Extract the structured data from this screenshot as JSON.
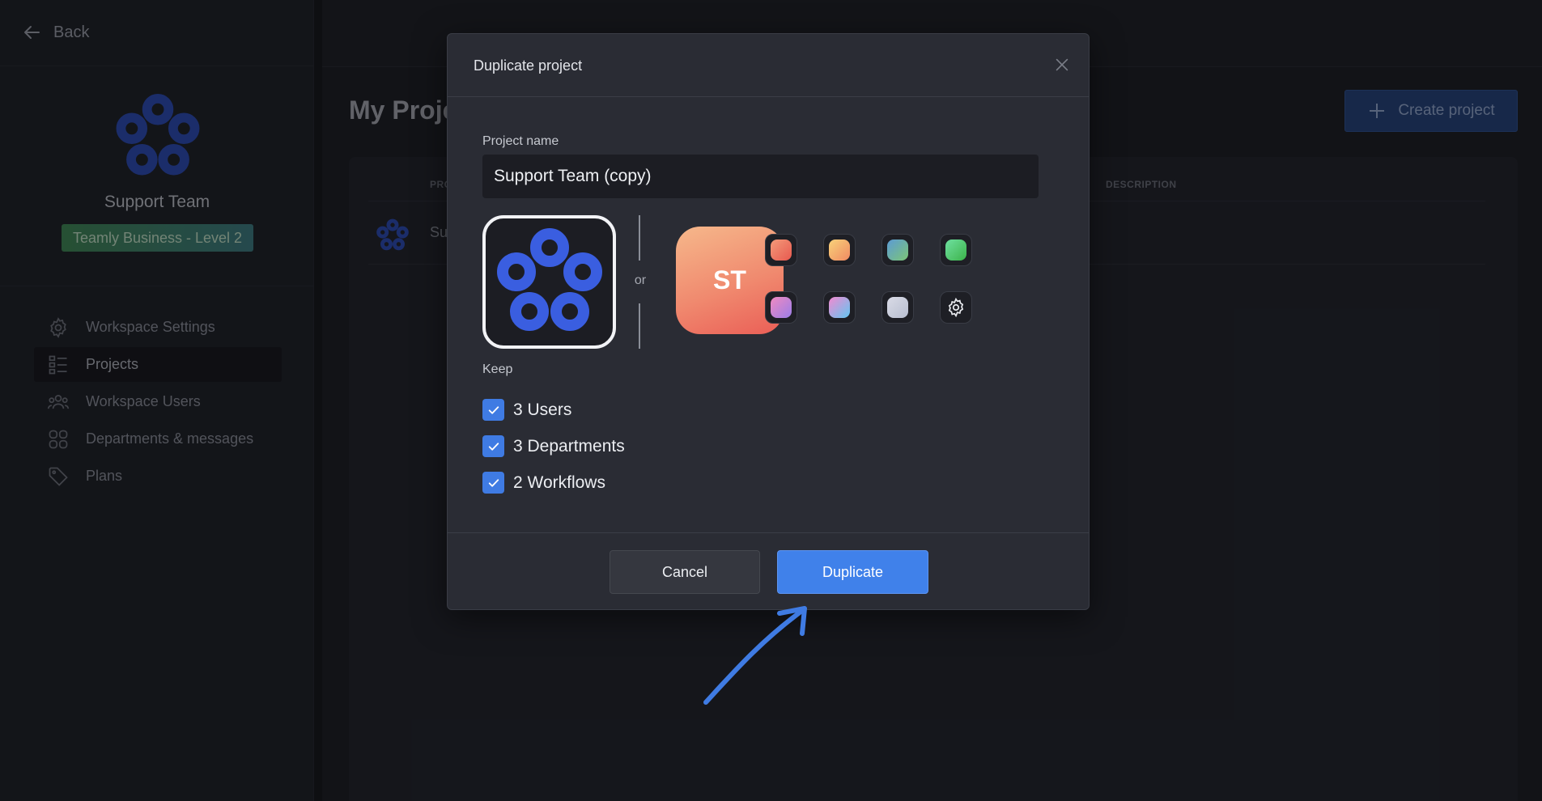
{
  "sidebar": {
    "back_label": "Back",
    "workspace_name": "Support Team",
    "plan_badge": "Teamly Business - Level 2",
    "items": [
      {
        "label": "Workspace Settings",
        "icon": "gear-icon"
      },
      {
        "label": "Projects",
        "icon": "list-icon",
        "active": true
      },
      {
        "label": "Workspace Users",
        "icon": "users-icon"
      },
      {
        "label": "Departments & messages",
        "icon": "grid-icon"
      },
      {
        "label": "Plans",
        "icon": "tag-icon"
      }
    ]
  },
  "main": {
    "page_title": "My Proje",
    "create_button_label": "Create project",
    "table": {
      "col_project": "PRO",
      "col_description": "DESCRIPTION",
      "rows": [
        {
          "name": "Su"
        }
      ]
    }
  },
  "modal": {
    "title": "Duplicate project",
    "project_name_label": "Project name",
    "project_name_value": "Support Team (copy)",
    "or_label": "or",
    "initials": "ST",
    "swatches": [
      {
        "colors": [
          "#f39a7a",
          "#e8594f"
        ]
      },
      {
        "colors": [
          "#f8d27a",
          "#f08a62"
        ]
      },
      {
        "colors": [
          "#5c9bd5",
          "#7cc576"
        ]
      },
      {
        "colors": [
          "#6fe0a0",
          "#3cb34a"
        ]
      },
      {
        "colors": [
          "#f08ac0",
          "#9b7ee8"
        ]
      },
      {
        "colors": [
          "#f28ad0",
          "#62c6f2"
        ]
      },
      {
        "colors": [
          "#d9dbe6",
          "#b8bed0"
        ]
      },
      {
        "icon": "settings-gear-icon"
      }
    ],
    "keep_label": "Keep",
    "keep_options": [
      {
        "label": "3 Users",
        "checked": true
      },
      {
        "label": "3 Departments",
        "checked": true
      },
      {
        "label": "2 Workflows",
        "checked": true
      }
    ],
    "cancel_label": "Cancel",
    "duplicate_label": "Duplicate"
  },
  "colors": {
    "accent": "#4081ea",
    "annotation_arrow": "#3f7be3"
  }
}
